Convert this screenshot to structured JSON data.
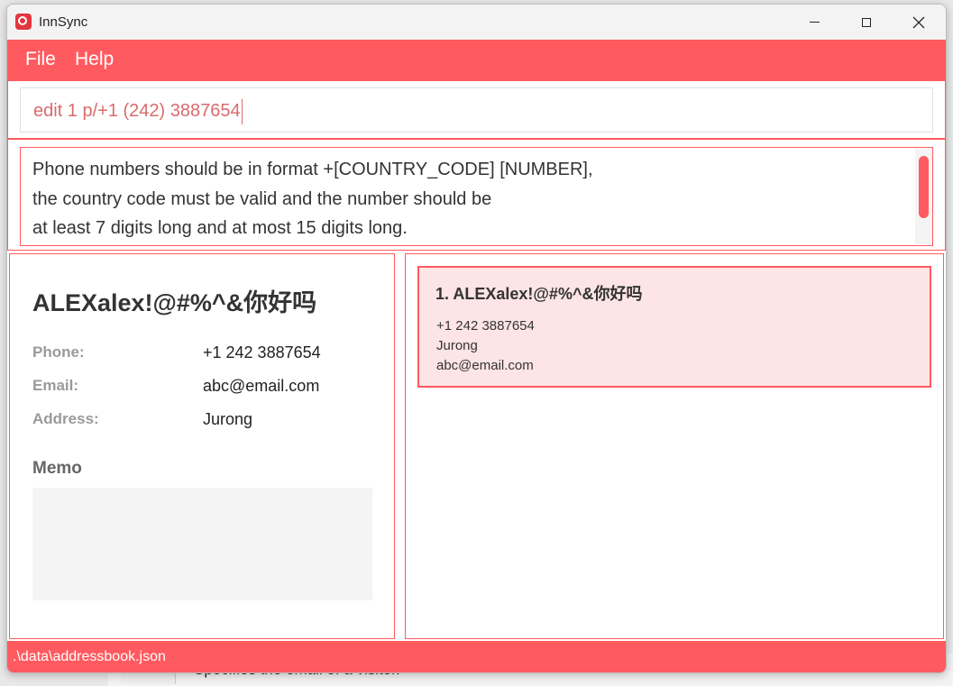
{
  "window": {
    "title": "InnSync"
  },
  "menu": {
    "file": "File",
    "help": "Help"
  },
  "command": {
    "value": "edit 1 p/+1 (242) 3887654"
  },
  "result": {
    "lines": [
      "Phone numbers should be in format +[COUNTRY_CODE] [NUMBER],",
      "the country code must be valid and the number should be",
      "at least 7 digits long and at most 15 digits long."
    ]
  },
  "detail": {
    "name": "ALEXalex!@#%^&你好吗",
    "phone_label": "Phone:",
    "phone": "+1 242 3887654",
    "email_label": "Email:",
    "email": "abc@email.com",
    "address_label": "Address:",
    "address": "Jurong",
    "memo_label": "Memo",
    "memo": ""
  },
  "list": {
    "items": [
      {
        "title": "1.  ALEXalex!@#%^&你好吗",
        "phone": "+1 242 3887654",
        "address": "Jurong",
        "email": "abc@email.com"
      }
    ]
  },
  "status": {
    "path": ".\\data\\addressbook.json"
  },
  "background": {
    "partial_text": "Specifies the email of a visitor."
  },
  "colors": {
    "accent": "#ff5a5f",
    "card_bg": "#fde4e6",
    "command_text": "#d96b6b"
  }
}
